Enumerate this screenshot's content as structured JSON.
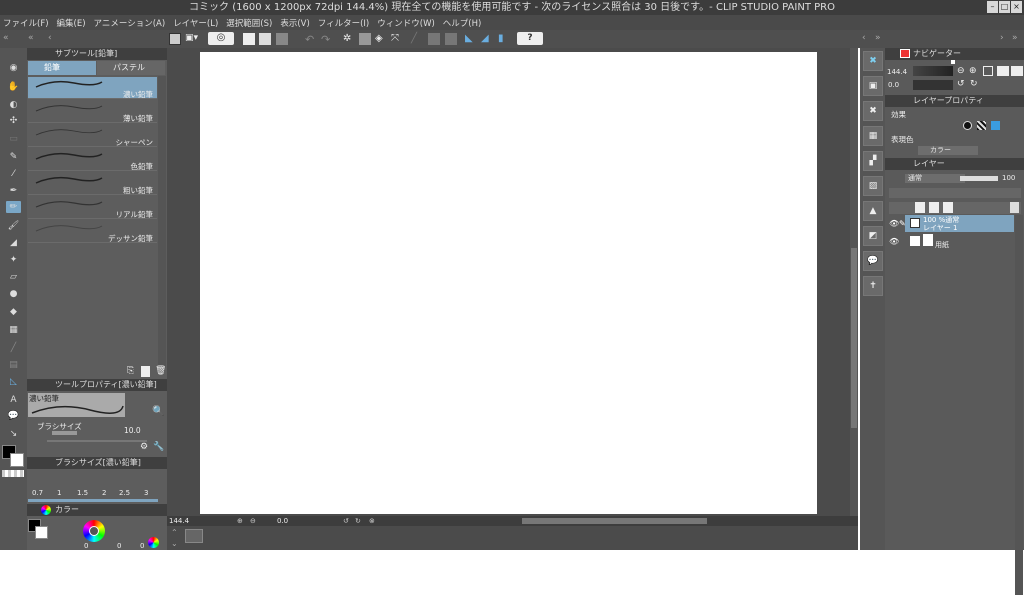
{
  "window": {
    "title": "コミック (1600 x 1200px 72dpi 144.4%)  現在全ての機能を使用可能です - 次のライセンス照合は 30 日後です。- CLIP STUDIO PAINT PRO"
  },
  "menu": [
    "ファイル(F)",
    "編集(E)",
    "アニメーション(A)",
    "レイヤー(L)",
    "選択範囲(S)",
    "表示(V)",
    "フィルター(I)",
    "ウィンドウ(W)",
    "ヘルプ(H)"
  ],
  "subtool": {
    "header": "サブツール[鉛筆]",
    "tabs": [
      "鉛筆",
      "パステル"
    ],
    "brushes": [
      "濃い鉛筆",
      "薄い鉛筆",
      "シャーペン",
      "色鉛筆",
      "粗い鉛筆",
      "リアル鉛筆",
      "デッサン鉛筆"
    ]
  },
  "toolprop": {
    "header": "ツールプロパティ[濃い鉛筆]",
    "brush_name": "濃い鉛筆",
    "size_label": "ブラシサイズ",
    "size_value": "10.0"
  },
  "brushsize": {
    "header": "ブラシサイズ[濃い鉛筆]",
    "sizes": [
      "0.7",
      "1",
      "1.5",
      "2",
      "2.5",
      "3"
    ]
  },
  "color": {
    "header": "カラー",
    "r": "0",
    "g": "0",
    "b": "0"
  },
  "status": {
    "zoom": "144.4",
    "angle": "0.0"
  },
  "navigator": {
    "header": "ナビゲーター",
    "zoom": "144.4",
    "angle": "0.0"
  },
  "layerprop": {
    "header": "レイヤープロパティ",
    "effect_label": "効果",
    "expression_label": "表現色",
    "expression_value": "カラー"
  },
  "layers": {
    "header": "レイヤー",
    "blend_mode": "通常",
    "opacity": "100",
    "items": [
      {
        "info": "100 %通常",
        "name": "レイヤー 1"
      },
      {
        "info": "",
        "name": "用紙"
      }
    ]
  },
  "colors": {
    "accent": "#7aa7c7"
  }
}
